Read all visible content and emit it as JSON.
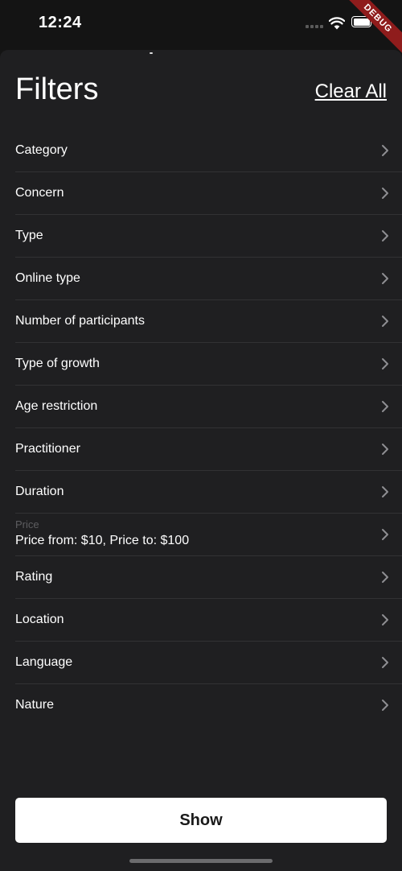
{
  "status_bar": {
    "time": "12:24",
    "debug_label": "DEBUG"
  },
  "header": {
    "title": "Filters",
    "clear_all_label": "Clear All"
  },
  "filters": [
    {
      "label": "Category"
    },
    {
      "label": "Concern"
    },
    {
      "label": "Type"
    },
    {
      "label": "Online type"
    },
    {
      "label": "Number of participants"
    },
    {
      "label": "Type of growth"
    },
    {
      "label": "Age restriction"
    },
    {
      "label": "Practitioner"
    },
    {
      "label": "Duration"
    },
    {
      "label": "Price",
      "value": "Price from: $10, Price to: $100"
    },
    {
      "label": "Rating"
    },
    {
      "label": "Location"
    },
    {
      "label": "Language"
    },
    {
      "label": "Nature"
    }
  ],
  "footer": {
    "show_label": "Show"
  },
  "colors": {
    "background": "#141414",
    "sheet": "#1f1f21",
    "divider": "#323234",
    "chevron": "#8e8e92",
    "button": "#ffffff",
    "debug_ribbon": "#8f1c1c"
  },
  "icons": {
    "row_trailing": "chevron-right-icon"
  }
}
